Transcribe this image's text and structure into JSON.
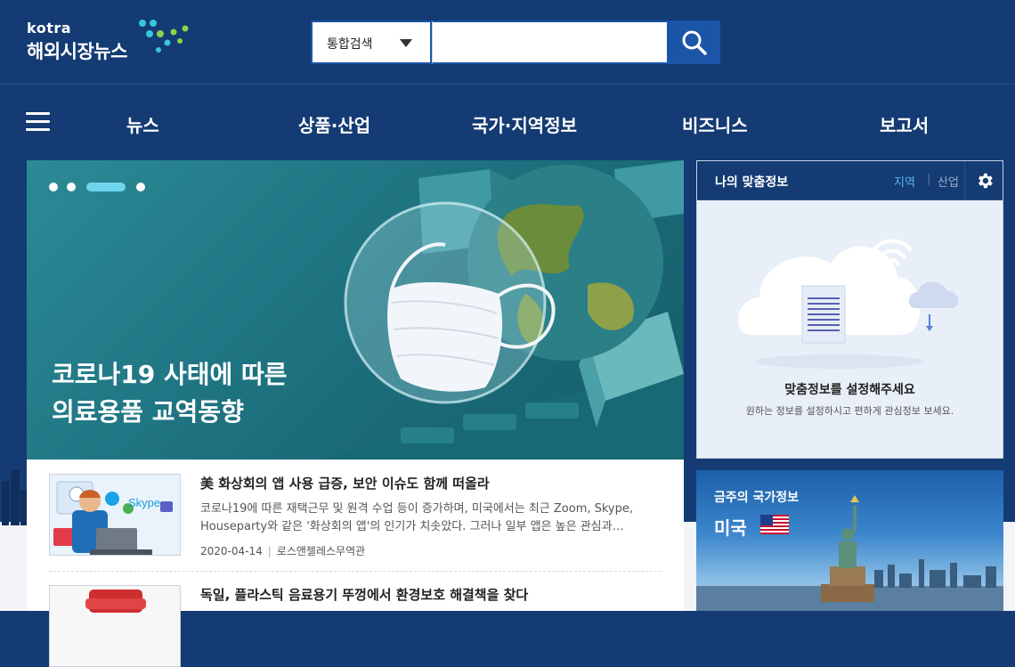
{
  "logo": {
    "brand": "kotra",
    "title": "해외시장뉴스"
  },
  "search": {
    "scope": "통합검색",
    "placeholder": ""
  },
  "nav": {
    "items": [
      {
        "label": "뉴스"
      },
      {
        "label": "상품·산업"
      },
      {
        "label": "국가·지역정보"
      },
      {
        "label": "비즈니스"
      },
      {
        "label": "보고서"
      }
    ]
  },
  "hero": {
    "title_line1": "코로나19 사태에 따른",
    "title_line2": "의료용품 교역동향",
    "active_slide": 3,
    "slide_count": 4
  },
  "news": {
    "items": [
      {
        "title": "美 화상회의 앱 사용 급증, 보안 이슈도 함께 떠올라",
        "summary": "코로나19에 따른 재택근무 및 원격 수업 등이 증가하며, 미국에서는 최근 Zoom, Skype, Houseparty와 같은 '화상회의 앱'의 인기가 치솟았다. 그러나 일부 앱은 높은 관심과…",
        "date": "2020-04-14",
        "source": "로스앤젤레스무역관",
        "thumb_text": "Skype"
      },
      {
        "title": "독일, 플라스틱 음료용기 뚜껑에서 환경보호 해결책을 찾다"
      }
    ]
  },
  "custom_info": {
    "title": "나의 맞춤정보",
    "tab_region": "지역",
    "tab_separator": "|",
    "tab_industry": "산업",
    "message": "맞춤정보를 설정해주세요",
    "sub_message": "원하는 정보를 설정하시고 편하게 관심정보 보세요."
  },
  "country_info": {
    "label": "금주의 국가정보",
    "country": "미국"
  },
  "colors": {
    "background": "#143b73",
    "accent": "#1a55a8",
    "hero": "#1f7482",
    "tab_active": "#5ab8f0"
  }
}
